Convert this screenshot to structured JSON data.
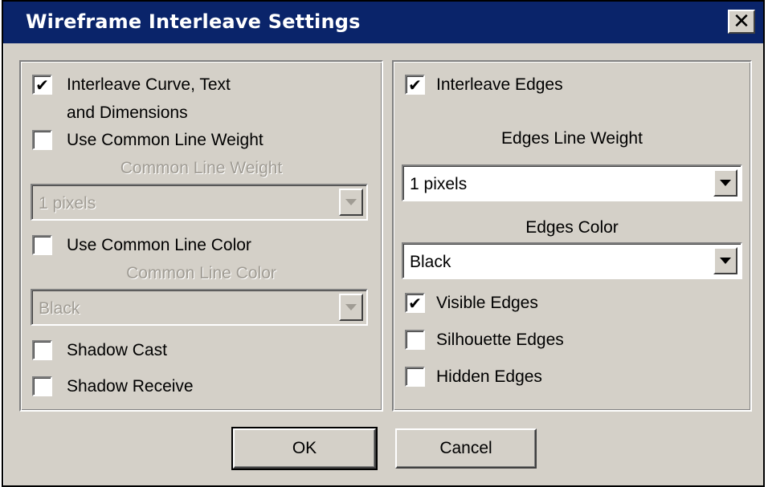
{
  "window": {
    "title": "Wireframe Interleave Settings",
    "close_glyph": "✕"
  },
  "left_panel": {
    "interleave_curve": {
      "label_line1": "Interleave Curve, Text",
      "label_line2": "and Dimensions",
      "checked": true
    },
    "use_common_line_weight": {
      "label": "Use Common Line Weight",
      "checked": false
    },
    "common_line_weight_label": "Common Line Weight",
    "common_line_weight_select": {
      "value": "1 pixels",
      "enabled": false
    },
    "use_common_line_color": {
      "label": "Use Common Line Color",
      "checked": false
    },
    "common_line_color_label": "Common Line Color",
    "common_line_color_select": {
      "value": "Black",
      "enabled": false
    },
    "shadow_cast": {
      "label": "Shadow Cast",
      "checked": false
    },
    "shadow_receive": {
      "label": "Shadow Receive",
      "checked": false
    }
  },
  "right_panel": {
    "interleave_edges": {
      "label": "Interleave Edges",
      "checked": true
    },
    "edges_line_weight_label": "Edges Line Weight",
    "edges_line_weight_select": {
      "value": "1 pixels",
      "enabled": true
    },
    "edges_color_label": "Edges Color",
    "edges_color_select": {
      "value": "Black",
      "enabled": true
    },
    "visible_edges": {
      "label": "Visible Edges",
      "checked": true
    },
    "silhouette_edges": {
      "label": "Silhouette Edges",
      "checked": false
    },
    "hidden_edges": {
      "label": "Hidden Edges",
      "checked": false
    }
  },
  "buttons": {
    "ok": "OK",
    "cancel": "Cancel"
  },
  "check_glyph": "✔",
  "colors": {
    "titlebar": "#0a246a",
    "dialog_bg": "#d4d0c8",
    "disabled_text": "#a09c94"
  }
}
